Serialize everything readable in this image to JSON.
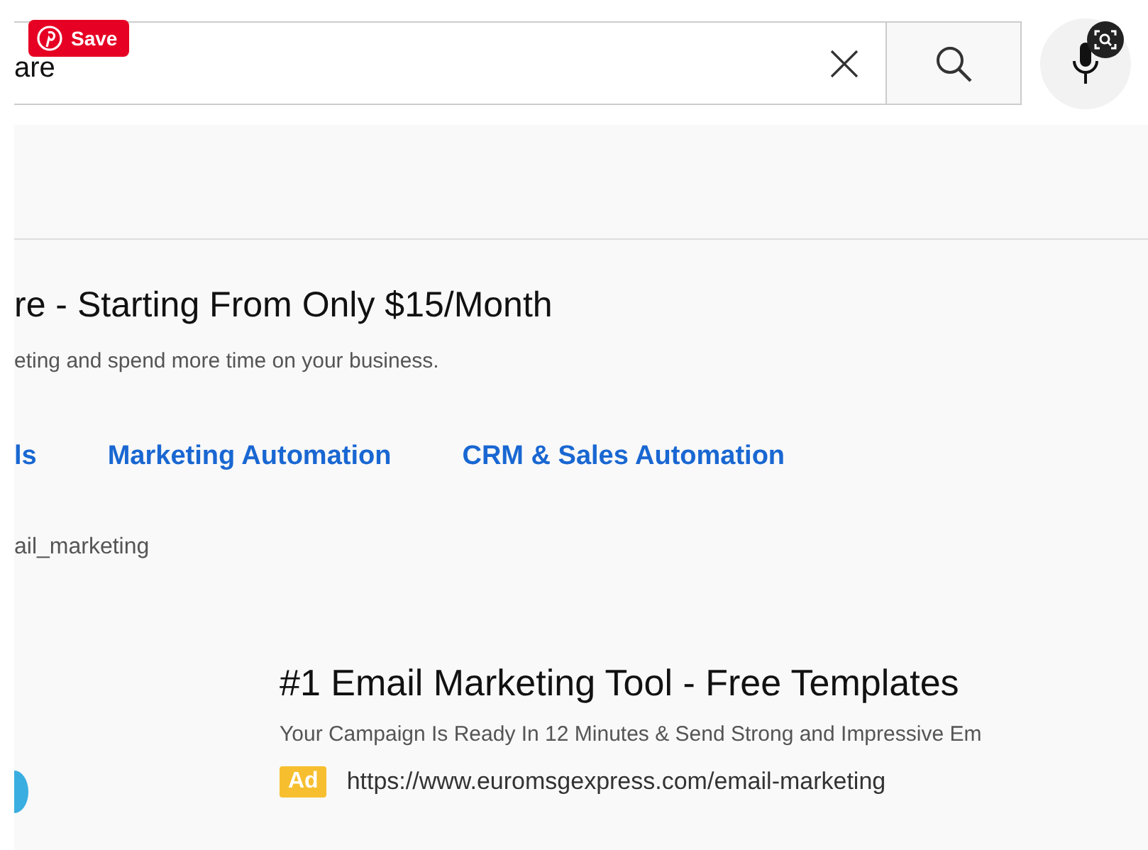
{
  "overlay": {
    "save_button": "Save"
  },
  "search": {
    "query": "are"
  },
  "ads": [
    {
      "kind": "sitelinks",
      "title": "re - Starting From Only $15/Month",
      "description": "eting and spend more time on your business.",
      "sitelinks": [
        "ls",
        "Marketing Automation",
        "CRM & Sales Automation"
      ],
      "url": "ail_marketing"
    },
    {
      "kind": "compact",
      "title": "#1 Email Marketing Tool - Free Templates",
      "description": "Your Campaign Is Ready In 12 Minutes & Send Strong and Impressive Em",
      "badge": "Ad",
      "url": "https://www.euromsgexpress.com/email-marketing"
    }
  ]
}
